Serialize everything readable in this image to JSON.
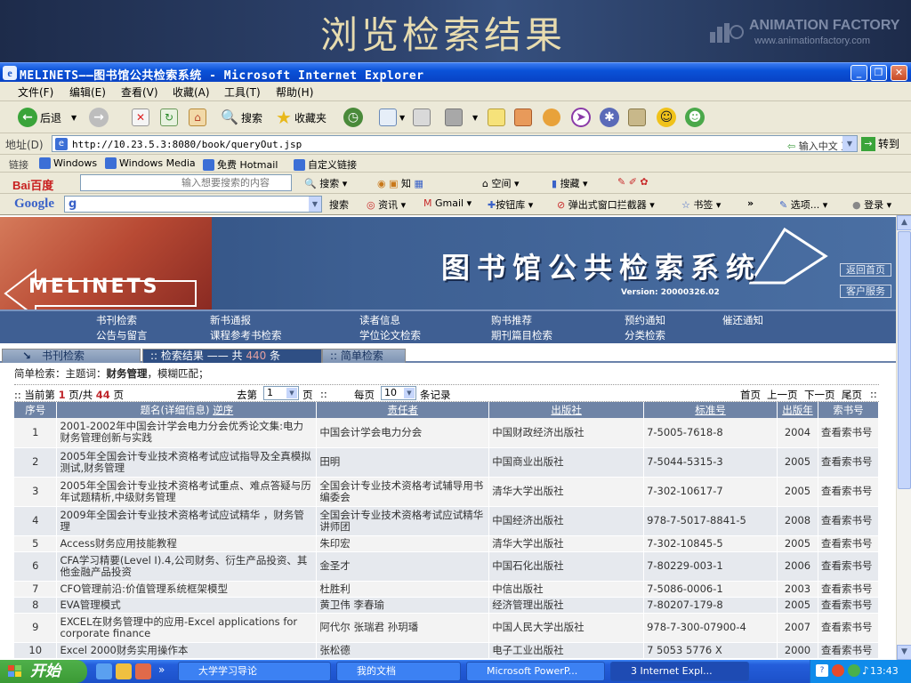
{
  "slide": {
    "title": "浏览检索结果",
    "brand": "ANIMATION FACTORY",
    "brand_url": "www.animationfactory.com"
  },
  "window": {
    "title": "MELINETS——图书馆公共检索系统 - Microsoft Internet Explorer"
  },
  "menu": [
    "文件(F)",
    "编辑(E)",
    "查看(V)",
    "收藏(A)",
    "工具(T)",
    "帮助(H)"
  ],
  "toolbar": {
    "back": "后退",
    "search": "搜索",
    "favorites": "收藏夹"
  },
  "address": {
    "label": "地址(D)",
    "url": "http://10.23.5.3:8080/book/queryOut.jsp",
    "hint": "输入中文 直达网站",
    "go": "转到"
  },
  "links": {
    "label": "链接",
    "items": [
      "Windows",
      "Windows Media",
      "免费 Hotmail",
      "自定义链接"
    ]
  },
  "baidu": {
    "logo": "Bai百度",
    "placeholder": "输入想要搜索的内容",
    "items": [
      "搜索",
      "知",
      "空间",
      "搜藏"
    ]
  },
  "google": {
    "logo": "Google",
    "g": "g",
    "items": [
      "搜索",
      "资讯",
      "Gmail",
      "按钮库",
      "弹出式窗口拦截器",
      "书签",
      "»",
      "选项...",
      "登录"
    ]
  },
  "lib": {
    "logo": "MELINETS",
    "title": "图书馆公共检索系统",
    "version": "Version: 20000326.02",
    "side": [
      "返回首页",
      "客户服务"
    ],
    "nav_row1": [
      "书刊检索",
      "新书通报",
      "读者信息",
      "购书推荐",
      "预约通知",
      "催还通知"
    ],
    "nav_row2": [
      "公告与留言",
      "课程参考书检索",
      "学位论文检索",
      "期刊篇目检索",
      "分类检索"
    ]
  },
  "tabs": {
    "search": "书刊检索",
    "result_prefix": ":: 检索结果 —— 共",
    "result_count": "440",
    "result_suffix": "条",
    "simple": ":: 简单检索"
  },
  "query_info": {
    "prefix": "简单检索：主题词：",
    "keyword": "财务管理",
    "suffix": "，模糊匹配；"
  },
  "pager": {
    "cur_prefix": ":: 当前第",
    "cur_page": "1",
    "page_mid": "页/共",
    "total_pages": "44",
    "page_unit": "页",
    "goto_label": "去第",
    "goto_value": "1",
    "goto_unit": "页",
    "sep": "::",
    "per_label": "每页",
    "per_value": "10",
    "per_unit": "条记录",
    "first": "首页",
    "prev": "上一页",
    "next": "下一页",
    "last": "尾页",
    "end": "::"
  },
  "table": {
    "headers": [
      "序号",
      "题名(详细信息)",
      "逆序",
      "责任者",
      "出版社",
      "标准号",
      "出版年",
      "索书号"
    ],
    "rows": [
      {
        "no": "1",
        "title": "2001-2002年中国会计学会电力分会优秀论文集:电力财务管理创新与实践",
        "author": "中国会计学会电力分会",
        "publisher": "中国财政经济出版社",
        "isbn": "7-5005-7618-8",
        "year": "2004",
        "link": "查看索书号"
      },
      {
        "no": "2",
        "title": "2005年全国会计专业技术资格考试应试指导及全真模拟测试,财务管理",
        "author": "田明",
        "publisher": "中国商业出版社",
        "isbn": "7-5044-5315-3",
        "year": "2005",
        "link": "查看索书号"
      },
      {
        "no": "3",
        "title": "2005年全国会计专业技术资格考试重点、难点答疑与历年试题精析,中级财务管理",
        "author": "全国会计专业技术资格考试辅导用书编委会",
        "publisher": "清华大学出版社",
        "isbn": "7-302-10617-7",
        "year": "2005",
        "link": "查看索书号"
      },
      {
        "no": "4",
        "title": "2009年全国会计专业技术资格考试应试精华 ，财务管理",
        "author": "全国会计专业技术资格考试应试精华讲师团",
        "publisher": "中国经济出版社",
        "isbn": "978-7-5017-8841-5",
        "year": "2008",
        "link": "查看索书号"
      },
      {
        "no": "5",
        "title": "Access财务应用技能教程",
        "author": "朱印宏",
        "publisher": "清华大学出版社",
        "isbn": "7-302-10845-5",
        "year": "2005",
        "link": "查看索书号"
      },
      {
        "no": "6",
        "title": "CFA学习精要(Level Ⅰ).4,公司财务、衍生产品投资、其他金融产品投资",
        "author": "金圣才",
        "publisher": "中国石化出版社",
        "isbn": "7-80229-003-1",
        "year": "2006",
        "link": "查看索书号"
      },
      {
        "no": "7",
        "title": "CFO管理前沿:价值管理系统框架模型",
        "author": "杜胜利",
        "publisher": "中信出版社",
        "isbn": "7-5086-0006-1",
        "year": "2003",
        "link": "查看索书号"
      },
      {
        "no": "8",
        "title": "EVA管理模式",
        "author": "黄卫伟 李春瑜",
        "publisher": "经济管理出版社",
        "isbn": "7-80207-179-8",
        "year": "2005",
        "link": "查看索书号"
      },
      {
        "no": "9",
        "title": "EXCEL在财务管理中的应用-Excel applications for corporate finance",
        "author": "阿代尔 张瑞君 孙玥璠",
        "publisher": "中国人民大学出版社",
        "isbn": "978-7-300-07900-4",
        "year": "2007",
        "link": "查看索书号"
      },
      {
        "no": "10",
        "title": "Excel 2000财务实用操作本",
        "author": "张松德",
        "publisher": "电子工业出版社",
        "isbn": "7 5053 5776 X",
        "year": "2000",
        "link": "查看索书号"
      }
    ]
  },
  "taskbar": {
    "start": "开始",
    "more": "»",
    "tasks": [
      "大学学习导论",
      "我的文档",
      "Microsoft PowerP...",
      "3 Internet Expl..."
    ],
    "time": "13:43"
  },
  "colors": {
    "accent": "#0a52d8",
    "header_bg": "#3f5f93",
    "link": "#1a4ea6",
    "count_red": "#c0282d"
  }
}
